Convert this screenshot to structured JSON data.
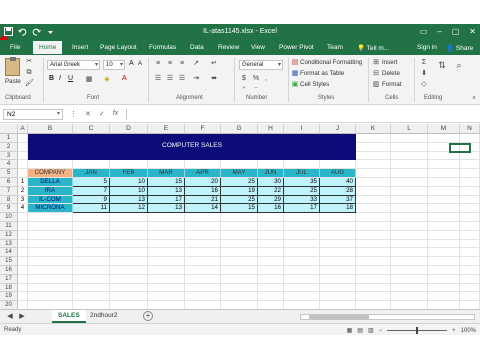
{
  "window": {
    "title": "IL-atas1145.xlsx - Excel"
  },
  "colors": {
    "excel_green": "#217346",
    "title_band": "#0b0b7a",
    "header_fill": "#f4b183",
    "month_fill": "#2ab5c9",
    "data_fill": "#bff3fb"
  },
  "ribbon_tabs": [
    {
      "label": "File"
    },
    {
      "label": "Home"
    },
    {
      "label": "Insert"
    },
    {
      "label": "Page Layout"
    },
    {
      "label": "Formulas"
    },
    {
      "label": "Data"
    },
    {
      "label": "Review"
    },
    {
      "label": "View"
    },
    {
      "label": "Power Pivot"
    },
    {
      "label": "Team"
    }
  ],
  "tell_me": "Tell m...",
  "sign_in": "Sign in",
  "share": "Share",
  "ribbon": {
    "paste": "Paste",
    "font_name": "Arial Greek",
    "font_size": "10",
    "number_format": "General",
    "conditional_formatting": "Conditional Formatting",
    "format_as_table": "Format as Table",
    "cell_styles": "Cell Styles",
    "insert": "Insert",
    "delete": "Delete",
    "format": "Format",
    "groups": {
      "clipboard": "Clipboard",
      "font": "Font",
      "alignment": "Alignment",
      "number": "Number",
      "styles": "Styles",
      "cells": "Cells",
      "editing": "Editing"
    }
  },
  "formula_bar": {
    "name_box": "N2",
    "fx": "fx"
  },
  "columns": [
    "A",
    "B",
    "C",
    "D",
    "E",
    "F",
    "G",
    "H",
    "I",
    "J",
    "K",
    "L",
    "M",
    "N"
  ],
  "rows": [
    "1",
    "2",
    "3",
    "4",
    "5",
    "6",
    "7",
    "8",
    "9",
    "10",
    "11",
    "12",
    "13",
    "14",
    "15",
    "16",
    "17",
    "18",
    "19",
    "20",
    "21"
  ],
  "sheet": {
    "title": "COMPUTER SALES",
    "company_header": "COMPANY",
    "months": [
      "JAN",
      "FEB",
      "MAR",
      "APR",
      "MAY",
      "JUN",
      "JUL",
      "AUG"
    ],
    "records": [
      {
        "no": "1",
        "company": "DELLA",
        "values": [
          "5",
          "10",
          "15",
          "20",
          "25",
          "30",
          "35",
          "40"
        ]
      },
      {
        "no": "2",
        "company": "IRA",
        "values": [
          "7",
          "10",
          "13",
          "16",
          "19",
          "22",
          "25",
          "28"
        ]
      },
      {
        "no": "3",
        "company": "IL-COM",
        "values": [
          "9",
          "13",
          "17",
          "21",
          "25",
          "29",
          "33",
          "37"
        ]
      },
      {
        "no": "4",
        "company": "MICRONA",
        "values": [
          "11",
          "12",
          "13",
          "14",
          "15",
          "16",
          "17",
          "18"
        ]
      }
    ]
  },
  "sheet_tabs": [
    "SALES",
    "2ndhour2"
  ],
  "status": {
    "ready": "Ready",
    "zoom": "100%"
  }
}
